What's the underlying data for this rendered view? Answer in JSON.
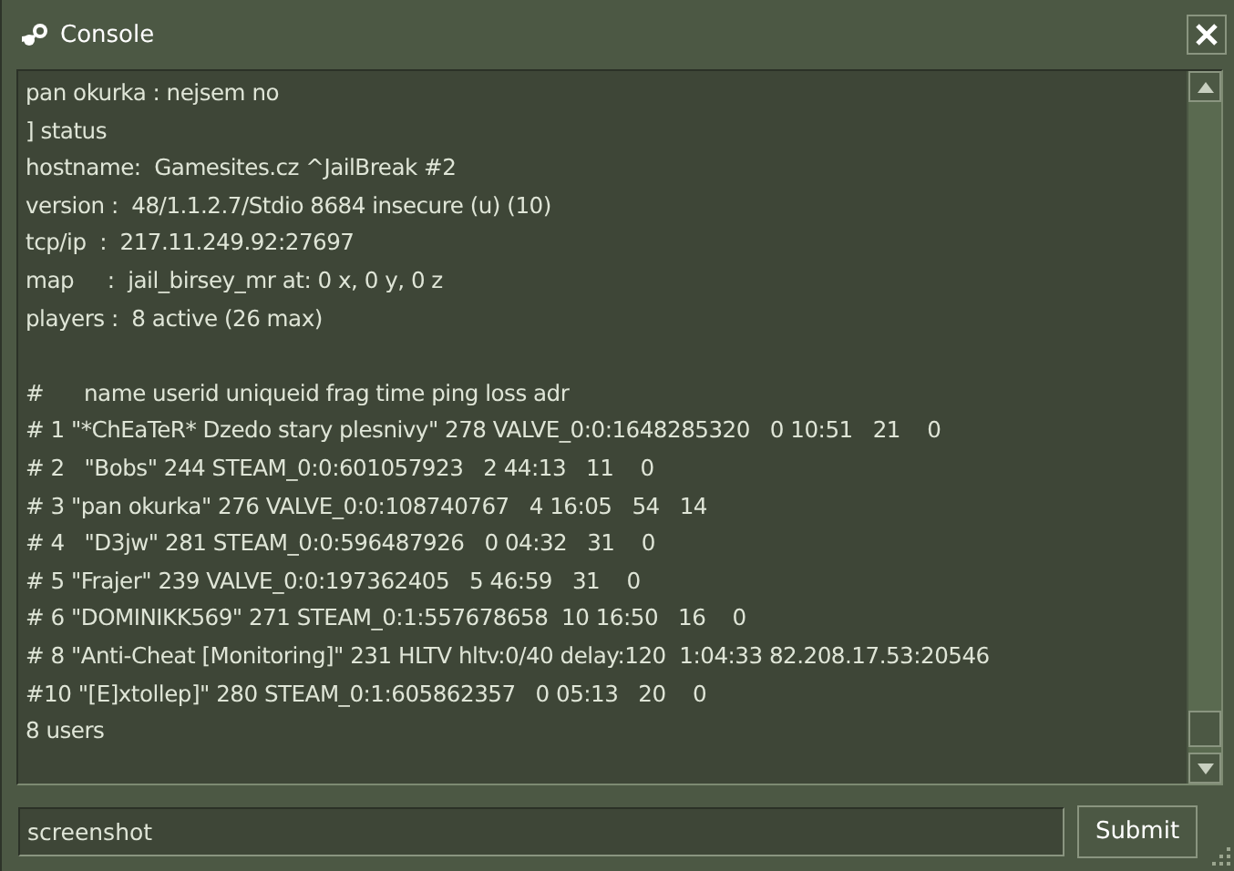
{
  "window": {
    "title": "Console"
  },
  "console": {
    "lines": [
      "pan okurka : nejsem no",
      "] status",
      "hostname:  Gamesites.cz ^JailBreak #2",
      "version :  48/1.1.2.7/Stdio 8684 insecure (u) (10)",
      "tcp/ip  :  217.11.249.92:27697",
      "map     :  jail_birsey_mr at: 0 x, 0 y, 0 z",
      "players :  8 active (26 max)"
    ],
    "table_lines": [
      "#      name userid uniqueid frag time ping loss adr",
      "# 1 \"*ChEaTeR* Dzedo stary plesnivy\" 278 VALVE_0:0:1648285320   0 10:51   21    0",
      "# 2   \"Bobs\" 244 STEAM_0:0:601057923   2 44:13   11    0",
      "# 3 \"pan okurka\" 276 VALVE_0:0:108740767   4 16:05   54   14",
      "# 4   \"D3jw\" 281 STEAM_0:0:596487926   0 04:32   31    0",
      "# 5 \"Frajer\" 239 VALVE_0:0:197362405   5 46:59   31    0",
      "# 6 \"DOMINIKK569\" 271 STEAM_0:1:557678658  10 16:50   16    0",
      "# 8 \"Anti-Cheat [Monitoring]\" 231 HLTV hltv:0/40 delay:120  1:04:33 82.208.17.53:20546",
      "#10 \"[E]xtollep]\" 280 STEAM_0:1:605862357   0 05:13   20    0",
      "8 users"
    ]
  },
  "input": {
    "value": "screenshot"
  },
  "submit_button": "Submit"
}
